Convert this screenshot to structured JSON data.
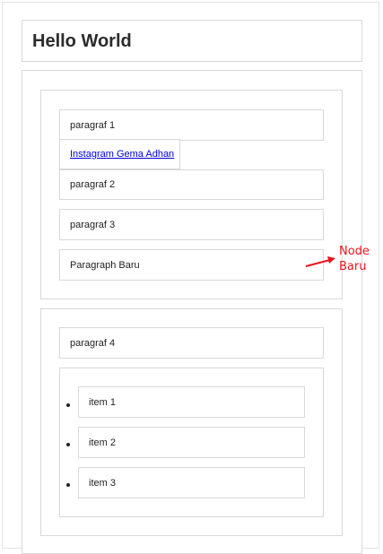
{
  "header": {
    "title": "Hello World"
  },
  "section1": {
    "paragraph1": "paragraf 1",
    "link_text": "Instagram Gema Adhan",
    "paragraph2": "paragraf 2",
    "paragraph3": "paragraf 3",
    "new_paragraph": "Paragraph Baru"
  },
  "annotation": {
    "line1": "Node",
    "line2": "Baru",
    "color": "#e8141c"
  },
  "section2": {
    "paragraph4": "paragraf 4",
    "items": [
      "item 1",
      "item 2",
      "item 3"
    ]
  }
}
